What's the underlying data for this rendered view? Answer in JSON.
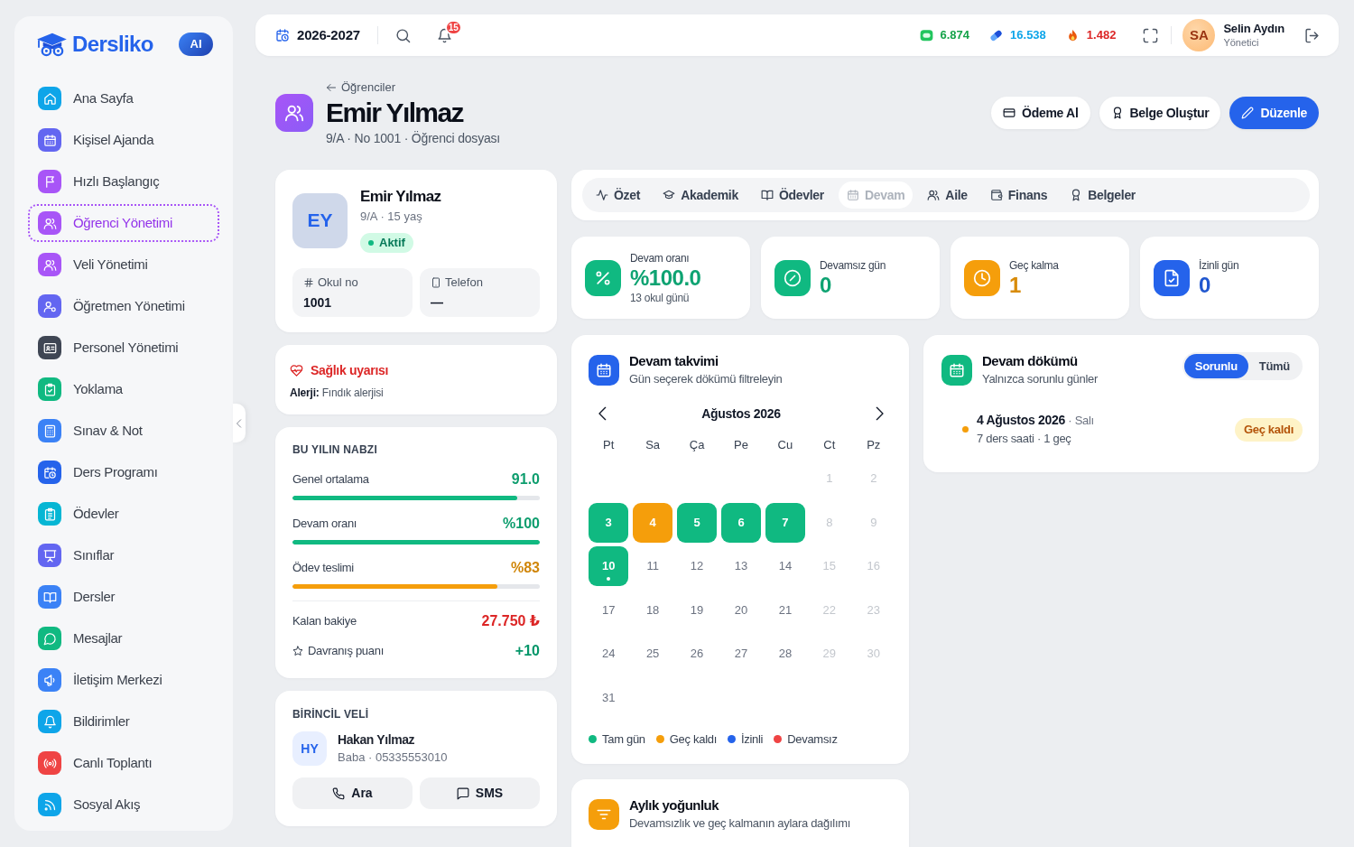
{
  "sidebar": {
    "brand": "Dersliko",
    "badge": "AI",
    "items": [
      {
        "label": "Ana Sayfa",
        "color": "#0ea5e9",
        "selected": false
      },
      {
        "label": "Kişisel Ajanda",
        "color": "#6366f1",
        "selected": false
      },
      {
        "label": "Hızlı Başlangıç",
        "color": "#a855f7",
        "selected": false
      },
      {
        "label": "Öğrenci Yönetimi",
        "color": "#a855f7",
        "selected": true
      },
      {
        "label": "Veli Yönetimi",
        "color": "#a855f7",
        "selected": false
      },
      {
        "label": "Öğretmen Yönetimi",
        "color": "#6366f1",
        "selected": false
      },
      {
        "label": "Personel Yönetimi",
        "color": "#3f4654",
        "selected": false
      },
      {
        "label": "Yoklama",
        "color": "#10b981",
        "selected": false
      },
      {
        "label": "Sınav & Not",
        "color": "#3b82f6",
        "selected": false
      },
      {
        "label": "Ders Programı",
        "color": "#2563eb",
        "selected": false
      },
      {
        "label": "Ödevler",
        "color": "#06b6d4",
        "selected": false
      },
      {
        "label": "Sınıflar",
        "color": "#6366f1",
        "selected": false
      },
      {
        "label": "Dersler",
        "color": "#3b82f6",
        "selected": false
      },
      {
        "label": "Mesajlar",
        "color": "#10b981",
        "selected": false
      },
      {
        "label": "İletişim Merkezi",
        "color": "#3b82f6",
        "selected": false
      },
      {
        "label": "Bildirimler",
        "color": "#0ea5e9",
        "selected": false
      },
      {
        "label": "Canlı Toplantı",
        "color": "#ef4444",
        "selected": false
      },
      {
        "label": "Sosyal Akış",
        "color": "#0ea5e9",
        "selected": false
      }
    ]
  },
  "topbar": {
    "year": "2026-2027",
    "notifications": "15",
    "counters": [
      {
        "value": "6.874",
        "color": "#16a34a"
      },
      {
        "value": "16.538",
        "color": "#0ea5e9"
      },
      {
        "value": "1.482",
        "color": "#dc2626"
      }
    ],
    "user": {
      "initials": "SA",
      "name": "Selin Aydın",
      "role": "Yönetici"
    }
  },
  "header": {
    "back": "Öğrenciler",
    "title": "Emir Yılmaz",
    "meta": "9/A · No 1001 · Öğrenci dosyası",
    "actions": [
      {
        "label": "Ödeme Al",
        "kind": "secondary"
      },
      {
        "label": "Belge Oluştur",
        "kind": "secondary"
      },
      {
        "label": "Düzenle",
        "kind": "primary"
      }
    ]
  },
  "profile": {
    "initials": "EY",
    "name": "Emir Yılmaz",
    "meta": "9/A · 15 yaş",
    "status": "Aktif",
    "fields": [
      {
        "label": "Okul no",
        "value": "1001"
      },
      {
        "label": "Telefon",
        "value": "—"
      }
    ]
  },
  "health": {
    "title": "Sağlık uyarısı",
    "text": "**Alerji:** Fındık alerjisi"
  },
  "pulse": {
    "title": "BU YILIN NABZI",
    "metrics": [
      {
        "label": "Genel ortalama",
        "value": "91.0",
        "level": 0.91,
        "color": "#10b981"
      },
      {
        "label": "Devam oranı",
        "value": "%100",
        "level": 1,
        "color": "#10b981"
      },
      {
        "label": "Ödev teslimi",
        "value": "%83",
        "level": 0.83,
        "color": "#f59e0b"
      }
    ],
    "facts": [
      {
        "label": "Kalan bakiye",
        "value": "27.750 ₺",
        "color": "#dc2626"
      },
      {
        "label": "Davranış puanı",
        "value": "+10",
        "color": "#059669"
      }
    ]
  },
  "guardian": {
    "title": "BİRİNCİL VELİ",
    "initials": "HY",
    "name": "Hakan Yılmaz",
    "meta": "Baba · 05335553010",
    "actions": [
      "Ara",
      "SMS"
    ]
  },
  "tabs": [
    {
      "label": "Özet",
      "selected": false
    },
    {
      "label": "Akademik",
      "selected": false
    },
    {
      "label": "Ödevler",
      "selected": false
    },
    {
      "label": "Devam",
      "selected": true
    },
    {
      "label": "Aile",
      "selected": false
    },
    {
      "label": "Finans",
      "selected": false
    },
    {
      "label": "Belgeler",
      "selected": false
    }
  ],
  "stats": [
    {
      "label": "Devam oranı",
      "value": "%100.0",
      "sub": "13 okul günü",
      "color": "#10b981"
    },
    {
      "label": "Devamsız gün",
      "value": "0",
      "color": "#10b981"
    },
    {
      "label": "Geç kalma",
      "value": "1",
      "color": "#f59e0b"
    },
    {
      "label": "İzinli gün",
      "value": "0",
      "color": "#2563eb"
    }
  ],
  "calendar": {
    "title": "Devam takvimi",
    "subtitle": "Gün seçerek dökümü filtreleyin",
    "month": "Ağustos 2026",
    "weekdays": [
      "Pt",
      "Sa",
      "Ça",
      "Pe",
      "Cu",
      "Ct",
      "Pz"
    ],
    "weeks": [
      [
        {
          "day": "1",
          "kind": "plain",
          "weekend": true,
          "today": false
        },
        {
          "day": "2",
          "kind": "plain",
          "weekend": true,
          "today": false
        }
      ],
      [
        {
          "day": "3",
          "kind": "full",
          "weekend": false,
          "today": false
        },
        {
          "day": "4",
          "kind": "late",
          "weekend": false,
          "today": false
        },
        {
          "day": "5",
          "kind": "full",
          "weekend": false,
          "today": false
        },
        {
          "day": "6",
          "kind": "full",
          "weekend": false,
          "today": false
        },
        {
          "day": "7",
          "kind": "full",
          "weekend": false,
          "today": false
        },
        {
          "day": "8",
          "kind": "plain",
          "weekend": true,
          "today": false
        },
        {
          "day": "9",
          "kind": "plain",
          "weekend": true,
          "today": false
        }
      ],
      [
        {
          "day": "10",
          "kind": "full",
          "weekend": false,
          "today": true
        },
        {
          "day": "11",
          "kind": "plain",
          "weekend": false,
          "today": false
        },
        {
          "day": "12",
          "kind": "plain",
          "weekend": false,
          "today": false
        },
        {
          "day": "13",
          "kind": "plain",
          "weekend": false,
          "today": false
        },
        {
          "day": "14",
          "kind": "plain",
          "weekend": false,
          "today": false
        },
        {
          "day": "15",
          "kind": "plain",
          "weekend": true,
          "today": false
        },
        {
          "day": "16",
          "kind": "plain",
          "weekend": true,
          "today": false
        }
      ],
      [
        {
          "day": "17",
          "kind": "plain",
          "weekend": false,
          "today": false
        },
        {
          "day": "18",
          "kind": "plain",
          "weekend": false,
          "today": false
        },
        {
          "day": "19",
          "kind": "plain",
          "weekend": false,
          "today": false
        },
        {
          "day": "20",
          "kind": "plain",
          "weekend": false,
          "today": false
        },
        {
          "day": "21",
          "kind": "plain",
          "weekend": false,
          "today": false
        },
        {
          "day": "22",
          "kind": "plain",
          "weekend": true,
          "today": false
        },
        {
          "day": "23",
          "kind": "plain",
          "weekend": true,
          "today": false
        }
      ],
      [
        {
          "day": "24",
          "kind": "plain",
          "weekend": false,
          "today": false
        },
        {
          "day": "25",
          "kind": "plain",
          "weekend": false,
          "today": false
        },
        {
          "day": "26",
          "kind": "plain",
          "weekend": false,
          "today": false
        },
        {
          "day": "27",
          "kind": "plain",
          "weekend": false,
          "today": false
        },
        {
          "day": "28",
          "kind": "plain",
          "weekend": false,
          "today": false
        },
        {
          "day": "29",
          "kind": "plain",
          "weekend": true,
          "today": false
        },
        {
          "day": "30",
          "kind": "plain",
          "weekend": true,
          "today": false
        }
      ],
      [
        {
          "day": "31",
          "kind": "plain",
          "weekend": false,
          "today": false
        }
      ]
    ],
    "legend": [
      {
        "label": "Tam gün",
        "color": "#10b981"
      },
      {
        "label": "Geç kaldı",
        "color": "#f59e0b"
      },
      {
        "label": "İzinli",
        "color": "#2563eb"
      },
      {
        "label": "Devamsız",
        "color": "#ef4444"
      }
    ]
  },
  "breakdown": {
    "title": "Devam dökümü",
    "subtitle": "Yalnızca sorunlu günler",
    "filters": [
      {
        "label": "Sorunlu",
        "selected": true
      },
      {
        "label": "Tümü",
        "selected": false
      }
    ],
    "entries": [
      {
        "date": "**4 Ağustos 2026** · Salı",
        "detail": "7 ders saati · 1 geç",
        "status": "Geç kaldı",
        "color": "#f59e0b"
      }
    ]
  },
  "monthly": {
    "title": "Aylık yoğunluk",
    "subtitle": "Devamsızlık ve geç kalmanın aylara dağılımı"
  }
}
